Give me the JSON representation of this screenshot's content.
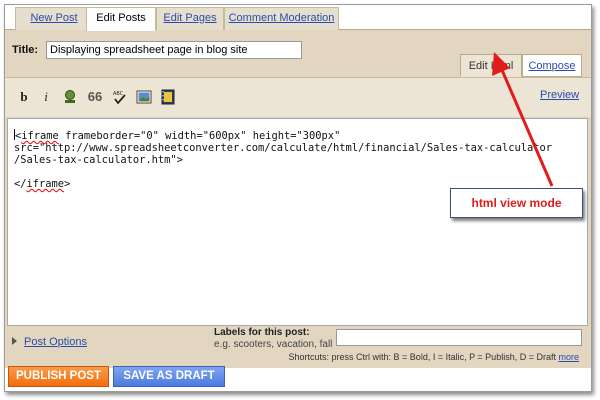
{
  "tabs": {
    "new_post": "New Post",
    "edit_posts": "Edit Posts",
    "edit_pages": "Edit Pages",
    "comment_moderation": "Comment Moderation"
  },
  "post": {
    "title_label": "Title:",
    "title_value": "Displaying spreadsheet page in blog site"
  },
  "editor_modes": {
    "edit_html": "Edit Html",
    "compose": "Compose"
  },
  "toolbar": {
    "bold": "b",
    "italic": "i",
    "quote": "66",
    "spell": "ABC",
    "preview": "Preview",
    "icons": [
      "bold-icon",
      "italic-icon",
      "text-color-icon",
      "blockquote-icon",
      "spellcheck-icon",
      "insert-image-icon",
      "insert-video-icon"
    ]
  },
  "editor": {
    "line1_spell": "iframe",
    "line1_rest": " frameborder=\"0\" width=\"600px\" height=\"300px\"",
    "line2": "src=\"http://www.spreadsheetconverter.com/calculate/html/financial/Sales-tax-calculator",
    "line3": "/Sales-tax-calculator.htm\">",
    "line4_open": "</",
    "line4_spell": "iframe",
    "line4_close": ">"
  },
  "callout": {
    "text": "html view mode"
  },
  "post_options": {
    "link": "Post Options"
  },
  "labels": {
    "title": "Labels for this post:",
    "hint": "e.g. scooters, vacation, fall",
    "value": ""
  },
  "shortcuts": {
    "text": "Shortcuts: press Ctrl with: B = Bold, I = Italic, P = Publish, D = Draft",
    "more": "more"
  },
  "buttons": {
    "publish": "PUBLISH POST",
    "draft": "SAVE AS DRAFT"
  },
  "colors": {
    "panel": "#e2d6c1",
    "link": "#2a4dab",
    "publish": "#f5801d",
    "draft": "#5b8be6",
    "annotation": "#e01c1c"
  }
}
